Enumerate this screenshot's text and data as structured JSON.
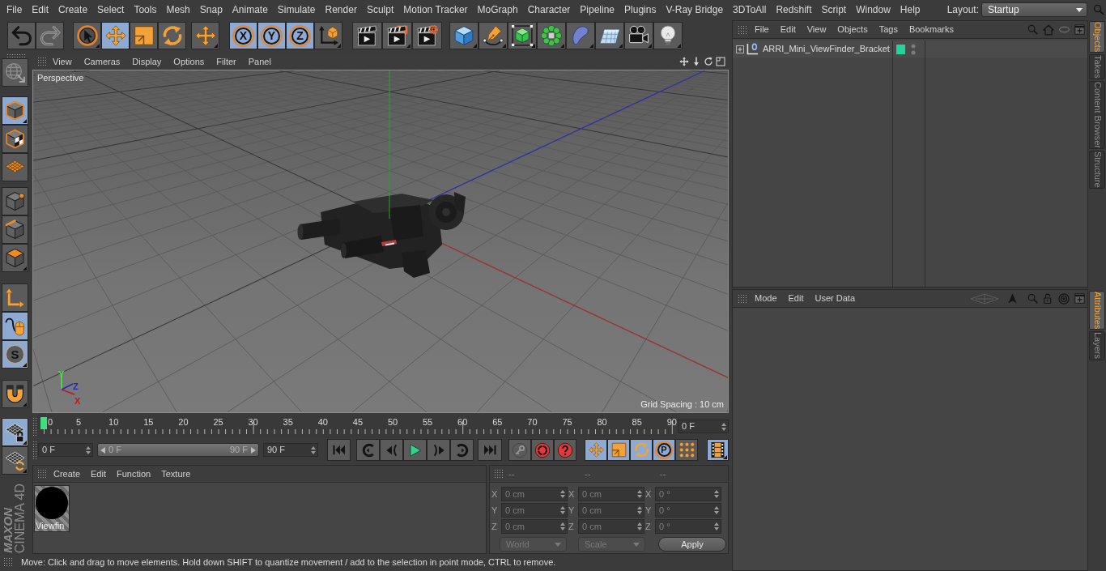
{
  "menu_bar": {
    "items": [
      "File",
      "Edit",
      "Create",
      "Select",
      "Tools",
      "Mesh",
      "Snap",
      "Animate",
      "Simulate",
      "Render",
      "Sculpt",
      "Motion Tracker",
      "MoGraph",
      "Character",
      "Pipeline",
      "Plugins",
      "V-Ray Bridge",
      "3DToAll",
      "Redshift",
      "Script",
      "Window",
      "Help"
    ],
    "layout_label": "Layout:",
    "layout_value": "Startup"
  },
  "main_toolbar": [
    [
      {
        "selected": false,
        "disabled": false
      },
      {
        "selected": false,
        "disabled": true
      }
    ],
    [
      {
        "selected": false
      },
      {
        "selected": true
      },
      {
        "selected": false
      },
      {
        "selected": false
      }
    ],
    [
      {
        "selected": false
      }
    ],
    [
      {
        "label": "X",
        "selected": true
      },
      {
        "label": "Y",
        "selected": true
      },
      {
        "label": "Z",
        "selected": true
      },
      {
        "selected": false
      }
    ],
    [
      {
        "selected": false
      },
      {
        "selected": false
      },
      {
        "selected": false
      }
    ],
    [
      {
        "selected": false
      },
      {
        "selected": false
      },
      {
        "selected": false
      },
      {
        "selected": false
      },
      {
        "selected": false
      },
      {
        "selected": false
      },
      {
        "selected": false
      },
      {
        "selected": false
      }
    ]
  ],
  "mode_toolbar": [
    [
      {
        "selected": false
      }
    ],
    [
      {
        "selected": true
      },
      {
        "selected": false
      },
      {
        "selected": false
      }
    ],
    [
      {
        "selected": false
      },
      {
        "selected": false
      },
      {
        "selected": false
      }
    ],
    [
      {
        "selected": false
      },
      {
        "selected": true
      },
      {
        "label": "S",
        "selected": true
      }
    ],
    [
      {
        "selected": false
      }
    ],
    [
      {
        "selected": true
      },
      {
        "selected": false
      }
    ]
  ],
  "logo": {
    "brand": "MAXON",
    "product": "CINEMA 4D"
  },
  "viewport": {
    "menu": [
      "View",
      "Cameras",
      "Display",
      "Options",
      "Filter",
      "Panel"
    ],
    "camera": "Perspective",
    "grid_spacing": "Grid Spacing : 10 cm",
    "axis_gizmo": [
      {
        "label": "Y",
        "color": "#44ea44"
      },
      {
        "label": "Z",
        "color": "#2626c4"
      },
      {
        "label": "X",
        "color": "#b81c1c"
      }
    ]
  },
  "timeline": {
    "labels": [
      "0",
      "5",
      "10",
      "15",
      "20",
      "25",
      "30",
      "35",
      "40",
      "45",
      "50",
      "55",
      "60",
      "65",
      "70",
      "75",
      "80",
      "85",
      "90"
    ],
    "playhead": {
      "level": 0
    },
    "current_frame": "0 F"
  },
  "playback": {
    "start": "0 F",
    "range_start": "0 F",
    "range_end": "90 F",
    "range_slider": {
      "level": 1
    },
    "end": "90 F",
    "key_buttons": [
      {
        "disabled": true
      },
      {
        "disabled": false
      },
      {
        "disabled": false
      }
    ],
    "tool_buttons": [
      {
        "selected": true
      },
      {
        "selected": true
      },
      {
        "selected": true
      },
      {
        "label": "P",
        "selected": true
      },
      {
        "selected": false
      }
    ],
    "timeline_toggle": {
      "selected": true
    }
  },
  "materials": {
    "menu": [
      "Create",
      "Edit",
      "Function",
      "Texture"
    ],
    "items": [
      {
        "name": "Viewfin"
      }
    ]
  },
  "coordinates": {
    "headers": [
      "--",
      "--",
      "--"
    ],
    "rows": [
      {
        "cells": [
          {
            "axis": "X",
            "value": "0 cm"
          },
          {
            "axis": "X",
            "value": "0 cm"
          },
          {
            "axis": "X",
            "value": "0 °"
          }
        ]
      },
      {
        "cells": [
          {
            "axis": "Y",
            "value": "0 cm"
          },
          {
            "axis": "Y",
            "value": "0 cm"
          },
          {
            "axis": "Y",
            "value": "0 °"
          }
        ]
      },
      {
        "cells": [
          {
            "axis": "Z",
            "value": "0 cm"
          },
          {
            "axis": "Z",
            "value": "0 cm"
          },
          {
            "axis": "Z",
            "value": "0 °"
          }
        ]
      }
    ],
    "dropdowns": [
      {
        "value": "World",
        "disabled": true
      },
      {
        "value": "Scale",
        "disabled": true
      }
    ],
    "apply": "Apply"
  },
  "status_bar": {
    "text": "Move: Click and drag to move elements. Hold down SHIFT to quantize movement / add to the selection in point mode, CTRL to remove."
  },
  "objects_panel": {
    "menu": [
      "File",
      "Edit",
      "View",
      "Objects",
      "Tags",
      "Bookmarks"
    ],
    "objects": [
      {
        "name": "ARRI_Mini_ViewFinder_Bracket",
        "expanded": false,
        "color": "#22d49c"
      }
    ]
  },
  "attributes_panel": {
    "menu": [
      "Mode",
      "Edit",
      "User Data"
    ]
  },
  "side_tabs_top": [
    {
      "label": "Objects",
      "selected": true
    },
    {
      "label": "Takes",
      "selected": false
    },
    {
      "label": "Content Browser",
      "selected": false
    },
    {
      "label": "Structure",
      "selected": false
    }
  ],
  "side_tabs_bottom": [
    {
      "label": "Attributes",
      "selected": true
    },
    {
      "label": "Layers",
      "selected": false
    }
  ]
}
